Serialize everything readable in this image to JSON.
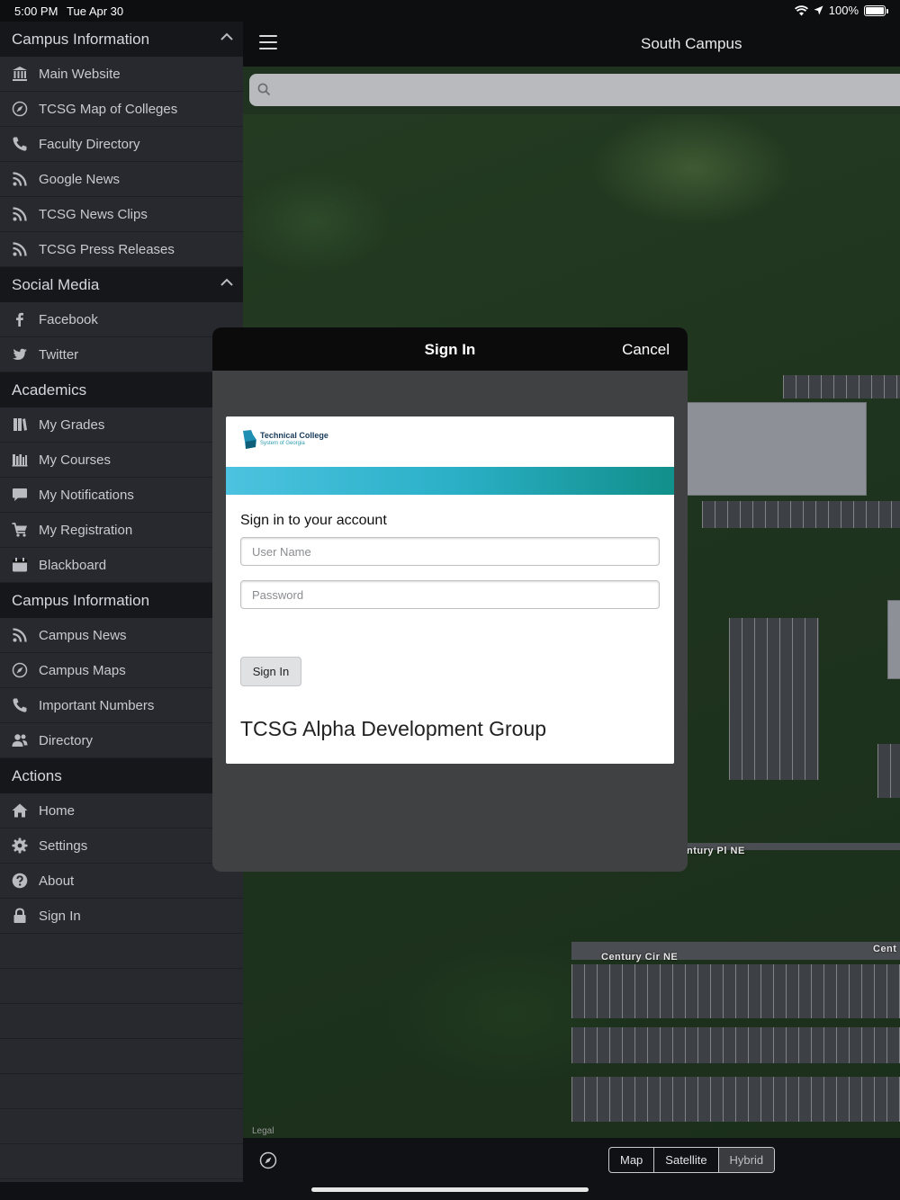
{
  "status": {
    "time": "5:00 PM",
    "date": "Tue Apr 30",
    "battery": "100%"
  },
  "sidebar": {
    "sections": [
      {
        "header": "Campus Information",
        "collapsible": true,
        "items": [
          {
            "label": "Main Website",
            "icon": "bank-icon"
          },
          {
            "label": "TCSG Map of Colleges",
            "icon": "compass-icon"
          },
          {
            "label": "Faculty Directory",
            "icon": "phone-icon"
          },
          {
            "label": "Google News",
            "icon": "rss-icon"
          },
          {
            "label": "TCSG News Clips",
            "icon": "rss-icon"
          },
          {
            "label": "TCSG Press Releases",
            "icon": "rss-icon"
          }
        ]
      },
      {
        "header": "Social Media",
        "collapsible": true,
        "items": [
          {
            "label": "Facebook",
            "icon": "facebook-icon"
          },
          {
            "label": "Twitter",
            "icon": "twitter-icon"
          }
        ]
      },
      {
        "header": "Academics",
        "items": [
          {
            "label": "My Grades",
            "icon": "book-icon"
          },
          {
            "label": "My Courses",
            "icon": "library-icon"
          },
          {
            "label": "My Notifications",
            "icon": "chat-icon"
          },
          {
            "label": "My Registration",
            "icon": "cart-icon"
          },
          {
            "label": "Blackboard",
            "icon": "calendar-icon"
          }
        ]
      },
      {
        "header": "Campus Information",
        "items": [
          {
            "label": "Campus News",
            "icon": "rss-icon"
          },
          {
            "label": "Campus Maps",
            "icon": "compass-icon"
          },
          {
            "label": "Important Numbers",
            "icon": "phone-icon"
          },
          {
            "label": "Directory",
            "icon": "users-icon"
          }
        ]
      },
      {
        "header": "Actions",
        "items": [
          {
            "label": "Home",
            "icon": "home-icon"
          },
          {
            "label": "Settings",
            "icon": "gear-icon"
          },
          {
            "label": "About",
            "icon": "question-icon"
          },
          {
            "label": "Sign In",
            "icon": "lock-icon"
          }
        ]
      }
    ]
  },
  "main": {
    "title": "South Campus",
    "search_placeholder": "",
    "road_labels": [
      "ntury Pl NE",
      "Century Cir NE",
      "Cent"
    ],
    "legal": "Legal",
    "map_types": [
      "Map",
      "Satellite",
      "Hybrid"
    ],
    "selected_map_type": "Hybrid"
  },
  "modal": {
    "title": "Sign In",
    "cancel": "Cancel",
    "logo_line1": "Technical College",
    "logo_line2": "System of Georgia",
    "heading": "Sign in to your account",
    "username_placeholder": "User Name",
    "password_placeholder": "Password",
    "button": "Sign In",
    "org": "TCSG Alpha Development Group"
  },
  "colors": {
    "sidebar_bg": "#27292e",
    "section_header_bg": "#16171b",
    "banner_start": "#4cc3e0",
    "banner_end": "#118f8a"
  }
}
